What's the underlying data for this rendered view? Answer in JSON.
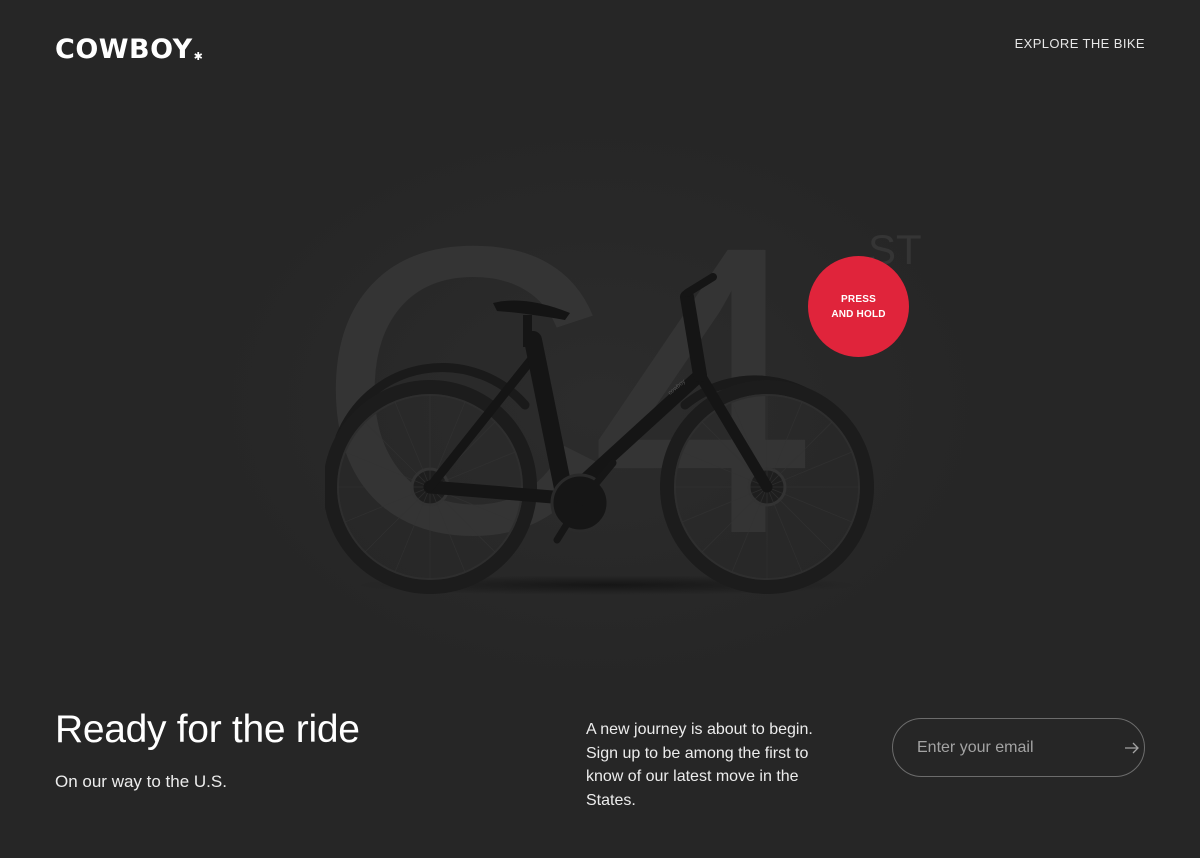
{
  "header": {
    "logo_text": "COWBOY",
    "logo_mark": "✱",
    "nav_link": "EXPLORE THE BIKE"
  },
  "hero": {
    "model_name": "C4",
    "model_suffix": "ST",
    "press_hold_line1": "PRESS",
    "press_hold_line2": "AND HOLD",
    "bike_image": "bike-illustration"
  },
  "footer": {
    "headline": "Ready for the ride",
    "subheadline": "On our way to the U.S.",
    "description": "A new journey is about to begin. Sign up to be among the first to know of our latest move in the States.",
    "email_placeholder": "Enter your email",
    "submit_icon": "arrow-right-icon"
  },
  "colors": {
    "background": "#262626",
    "accent": "#e0243b",
    "text": "#ffffff",
    "model_text": "#343434"
  }
}
